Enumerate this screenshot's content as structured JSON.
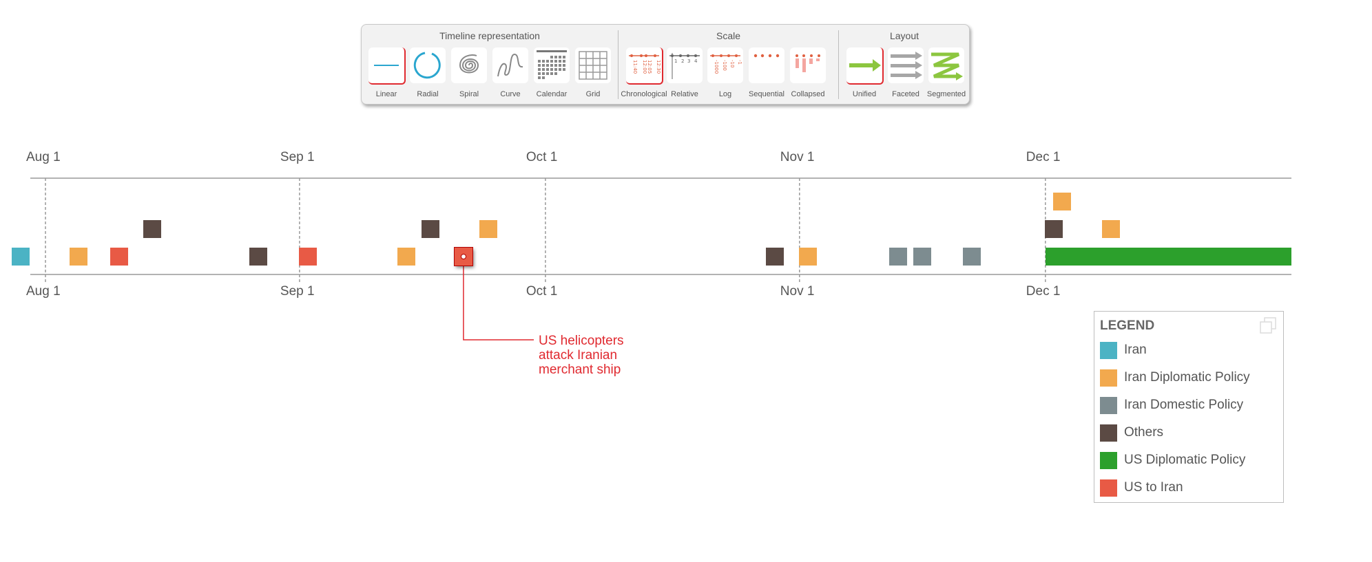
{
  "toolbar": {
    "groups": [
      {
        "title": "Timeline representation",
        "items": [
          "Linear",
          "Radial",
          "Spiral",
          "Curve",
          "Calendar",
          "Grid"
        ],
        "selected": "Linear"
      },
      {
        "title": "Scale",
        "items": [
          "Chronological",
          "Relative",
          "Log",
          "Sequential",
          "Collapsed"
        ],
        "selected": "Chronological"
      },
      {
        "title": "Layout",
        "items": [
          "Unified",
          "Faceted",
          "Segmented"
        ],
        "selected": "Unified"
      }
    ],
    "icon_text": {
      "chronological": [
        "11:40",
        "12:00",
        "12:05",
        "12:30"
      ],
      "relative": [
        "1",
        "2",
        "3",
        "4"
      ],
      "log": [
        "-1000",
        "-100",
        "-10",
        "-1"
      ]
    }
  },
  "axis": {
    "ticks": [
      "Aug 1",
      "Sep 1",
      "Oct 1",
      "Nov 1",
      "Dec 1"
    ]
  },
  "colors": {
    "Iran": "#4bb3c4",
    "Iran Diplomatic Policy": "#f2a94e",
    "Iran Domestic Policy": "#7d8c90",
    "Others": "#5b4a44",
    "US Diplomatic Policy": "#2ca02c",
    "US to Iran": "#e85a45",
    "accent": "#e0292f"
  },
  "events": [
    {
      "date": "Jul 29",
      "category": "Iran",
      "row": 0
    },
    {
      "date": "Aug 5",
      "category": "Iran Diplomatic Policy",
      "row": 0
    },
    {
      "date": "Aug 10",
      "category": "US to Iran",
      "row": 0
    },
    {
      "date": "Aug 14",
      "category": "Others",
      "row": 1
    },
    {
      "date": "Aug 27",
      "category": "Others",
      "row": 0
    },
    {
      "date": "Sep 2",
      "category": "US to Iran",
      "row": 0
    },
    {
      "date": "Sep 14",
      "category": "Iran Diplomatic Policy",
      "row": 0
    },
    {
      "date": "Sep 17",
      "category": "Others",
      "row": 1
    },
    {
      "date": "Sep 21",
      "category": "US to Iran",
      "row": 0,
      "selected": true
    },
    {
      "date": "Sep 24",
      "category": "Iran Diplomatic Policy",
      "row": 1
    },
    {
      "date": "Oct 29",
      "category": "Others",
      "row": 0
    },
    {
      "date": "Nov 2",
      "category": "Iran Diplomatic Policy",
      "row": 0
    },
    {
      "date": "Nov 13",
      "category": "Iran Domestic Policy",
      "row": 0
    },
    {
      "date": "Nov 16",
      "category": "Iran Domestic Policy",
      "row": 0
    },
    {
      "date": "Nov 22",
      "category": "Iran Domestic Policy",
      "row": 0
    },
    {
      "date": "Dec 2",
      "category": "Others",
      "row": 1
    },
    {
      "date": "Dec 3",
      "category": "Iran Diplomatic Policy",
      "row": 2
    },
    {
      "date": "Dec 9",
      "category": "Iran Diplomatic Policy",
      "row": 1
    },
    {
      "date": "Dec 1",
      "end": "Dec 31",
      "category": "US Diplomatic Policy",
      "row": 0
    }
  ],
  "annotation": {
    "text": "US helicopters attack Iranian merchant ship"
  },
  "legend": {
    "title": "LEGEND",
    "items": [
      "Iran",
      "Iran Diplomatic Policy",
      "Iran Domestic Policy",
      "Others",
      "US Diplomatic Policy",
      "US to Iran"
    ]
  }
}
